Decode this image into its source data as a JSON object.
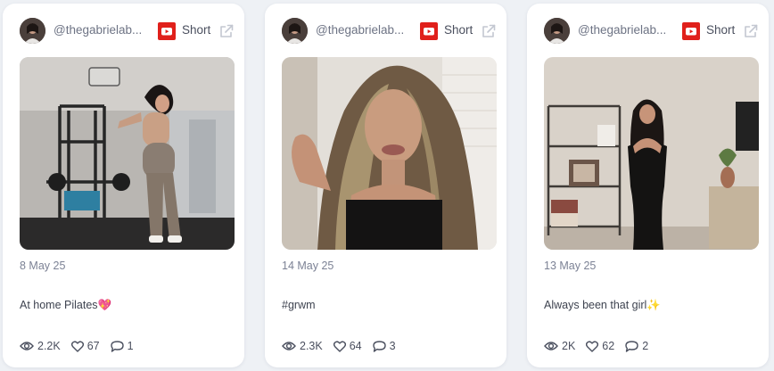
{
  "cards": [
    {
      "handle": "@thegabrielab...",
      "type_label": "Short",
      "date": "8 May 25",
      "caption": "At home Pilates💖",
      "views": "2.2K",
      "likes": "67",
      "comments": "1"
    },
    {
      "handle": "@thegabrielab...",
      "type_label": "Short",
      "date": "14 May 25",
      "caption": "#grwm",
      "views": "2.3K",
      "likes": "64",
      "comments": "3"
    },
    {
      "handle": "@thegabrielab...",
      "type_label": "Short",
      "date": "13 May 25",
      "caption": "Always been that girl✨",
      "views": "2K",
      "likes": "62",
      "comments": "2"
    }
  ],
  "colors": {
    "page_bg": "#eef1f5",
    "card_bg": "#ffffff",
    "youtube_red": "#e0201b",
    "muted_text": "#7c8295",
    "icon_gray": "#4a4f5e"
  },
  "icons": {
    "platform": "youtube-icon",
    "external": "external-link-icon",
    "views": "eye-icon",
    "likes": "heart-icon",
    "comments": "comment-icon"
  }
}
